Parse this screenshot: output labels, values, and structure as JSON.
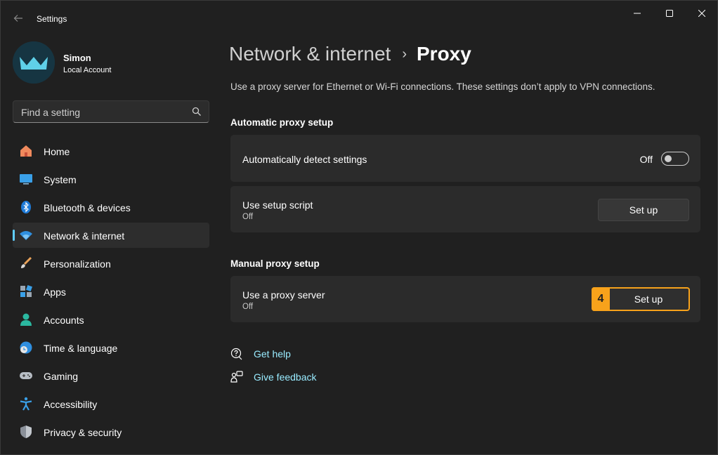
{
  "window": {
    "title": "Settings"
  },
  "profile": {
    "name": "Simon",
    "account_type": "Local Account"
  },
  "search": {
    "placeholder": "Find a setting"
  },
  "sidebar": {
    "items": [
      {
        "label": "Home",
        "icon": "home-icon"
      },
      {
        "label": "System",
        "icon": "system-icon"
      },
      {
        "label": "Bluetooth & devices",
        "icon": "bluetooth-icon"
      },
      {
        "label": "Network & internet",
        "icon": "wifi-icon",
        "active": true
      },
      {
        "label": "Personalization",
        "icon": "brush-icon"
      },
      {
        "label": "Apps",
        "icon": "apps-icon"
      },
      {
        "label": "Accounts",
        "icon": "accounts-icon"
      },
      {
        "label": "Time & language",
        "icon": "globe-clock-icon"
      },
      {
        "label": "Gaming",
        "icon": "gamepad-icon"
      },
      {
        "label": "Accessibility",
        "icon": "accessibility-icon"
      },
      {
        "label": "Privacy & security",
        "icon": "shield-icon"
      }
    ]
  },
  "header": {
    "parent": "Network & internet",
    "current": "Proxy"
  },
  "description": "Use a proxy server for Ethernet or Wi-Fi connections. These settings don’t apply to VPN connections.",
  "automatic": {
    "section_title": "Automatic proxy setup",
    "detect": {
      "label": "Automatically detect settings",
      "state": "Off"
    },
    "script": {
      "label": "Use setup script",
      "sub": "Off",
      "button": "Set up"
    }
  },
  "manual": {
    "section_title": "Manual proxy setup",
    "proxy": {
      "label": "Use a proxy server",
      "sub": "Off",
      "button": "Set up",
      "badge": "4"
    }
  },
  "links": {
    "help": "Get help",
    "feedback": "Give feedback"
  },
  "colors": {
    "accent": "#60cdff",
    "highlight": "#f7a21b",
    "background": "#202020",
    "card": "#2b2b2b"
  }
}
